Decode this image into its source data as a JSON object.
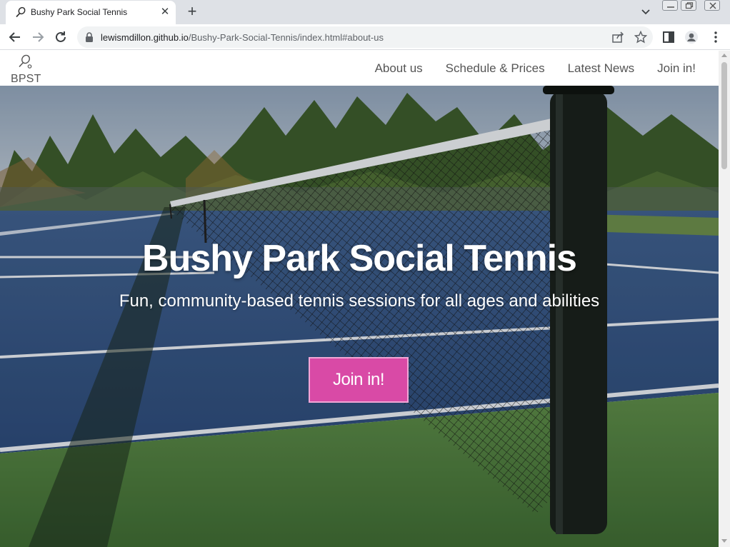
{
  "browser": {
    "tab_title": "Bushy Park Social Tennis",
    "url_host": "lewismdillon.github.io",
    "url_path": "/Bushy-Park-Social-Tennis/index.html#about-us"
  },
  "site": {
    "brand": "BPST",
    "nav": [
      {
        "label": "About us"
      },
      {
        "label": "Schedule & Prices"
      },
      {
        "label": "Latest News"
      },
      {
        "label": "Join in!"
      }
    ]
  },
  "hero": {
    "title": "Bushy Park Social Tennis",
    "subtitle": "Fun, community-based tennis sessions for all ages and abilities",
    "cta": "Join in!"
  },
  "colors": {
    "cta_background": "#d94aa6",
    "court_blue": "#2f4e7c",
    "court_green": "#4f7a3f"
  },
  "icons": [
    "tennis-racket-icon",
    "close-icon",
    "plus-icon",
    "chevron-down-icon",
    "back-arrow-icon",
    "forward-arrow-icon",
    "reload-icon",
    "lock-icon",
    "share-icon",
    "star-icon",
    "side-panel-icon",
    "profile-icon",
    "more-vert-icon"
  ]
}
